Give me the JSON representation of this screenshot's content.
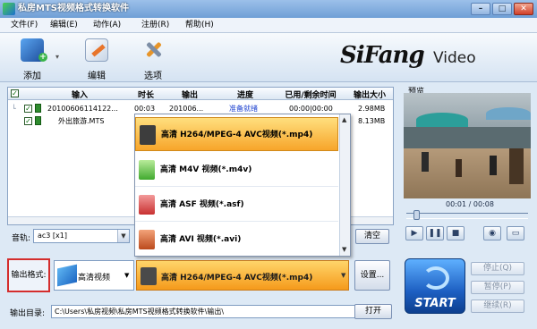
{
  "window": {
    "title": "私房MTS视频格式转换软件",
    "min": "–",
    "max": "□",
    "close": "✕"
  },
  "menu": [
    "文件(F)",
    "编辑(E)",
    "动作(A)",
    "注册(R)",
    "帮助(H)"
  ],
  "toolbar": {
    "add_label": "添加",
    "edit_label": "编辑",
    "options_label": "选项",
    "dropdown_arrow": "▾"
  },
  "logo": {
    "brand": "SiFang",
    "suffix": "Video"
  },
  "file_table": {
    "columns": [
      "输入",
      "时长",
      "输出",
      "进度",
      "已用/剩余时间",
      "输出大小"
    ],
    "rows": [
      {
        "input": "20100606114122...",
        "duration": "00:03",
        "output": "201006...",
        "progress": "准备就绪",
        "time": "00:00|00:00",
        "size": "2.98MB"
      },
      {
        "input": "外出旅游.MTS",
        "duration": "",
        "output": "",
        "progress": "",
        "time": "",
        "size": "8.13MB"
      }
    ]
  },
  "preview": {
    "label": "预览",
    "time": "00:01 / 00:08",
    "seek_position": 0.08
  },
  "player_buttons": {
    "play": "▶",
    "pause": "❚❚",
    "stop": "■",
    "snapshot": "◉",
    "fullscreen": "▭"
  },
  "audio": {
    "label": "音轨:",
    "value": "ac3 [x1]",
    "clear_label": "清空"
  },
  "output_format": {
    "label": "输出格式:",
    "category": "高清视频",
    "selected": "高清 H264/MPEG-4 AVC视频(*.mp4)",
    "settings_label": "设置..."
  },
  "format_list": [
    {
      "label": "高清 H264/MPEG-4 AVC视频(*.mp4)",
      "icon": "mp4-icon",
      "selected": true
    },
    {
      "label": "高清 M4V 视频(*.m4v)",
      "icon": "m4v-icon",
      "selected": false
    },
    {
      "label": "高清 ASF 视频(*.asf)",
      "icon": "asf-icon",
      "selected": false
    },
    {
      "label": "高清 AVI 视频(*.avi)",
      "icon": "avi-icon",
      "selected": false
    }
  ],
  "output_dir": {
    "label": "输出目录:",
    "value": "C:\\Users\\私房视频\\私房MTS视频格式转换软件\\输出\\",
    "open_label": "打开"
  },
  "actions": {
    "start_label": "START",
    "stop_label": "停止(Q)",
    "pause_label": "暂停(P)",
    "continue_label": "继续(R)"
  },
  "colors": {
    "accent": "#f59a1b",
    "start_blue": "#1d5fc2",
    "status_blue": "#1a3fcf",
    "highlight_border": "#d42d2d"
  }
}
